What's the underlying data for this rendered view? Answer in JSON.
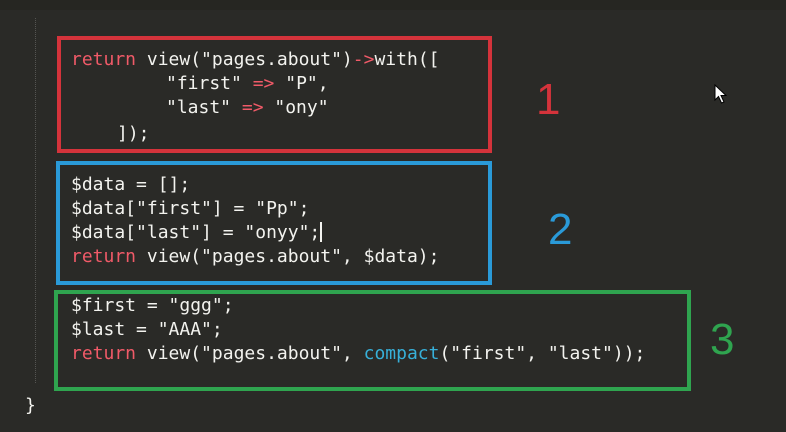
{
  "code": {
    "block1": {
      "l1_kw": "return",
      "l1_a": " view(\"pages.about\")",
      "l1_arrow": "->",
      "l1_b": "with([",
      "l2_a": "\"first\" ",
      "l2_op": "=>",
      "l2_b": " \"P\",",
      "l3_a": "\"last\" ",
      "l3_op": "=>",
      "l3_b": " \"ony\"",
      "l4": "]);"
    },
    "block2": {
      "l1": "$data = [];",
      "l2": "$data[\"first\"] = \"Pp\";",
      "l3": "$data[\"last\"] = \"onyy\";",
      "l4_kw": "return",
      "l4_rest": " view(\"pages.about\", $data);"
    },
    "block3": {
      "l1": "$first = \"ggg\";",
      "l2": "$last = \"AAA\";",
      "l3_kw": "return",
      "l3_a": " view(\"pages.about\", ",
      "l3_fn": "compact",
      "l3_b": "(\"first\", \"last\"));"
    },
    "closing_brace": "}"
  },
  "labels": {
    "one": "1",
    "two": "2",
    "three": "3"
  },
  "colors": {
    "box1": "#d4333b",
    "box2": "#2a9ad8",
    "box3": "#2fa44f",
    "keyword": "#f05a68",
    "function": "#37b0d9",
    "background": "#2a2a27"
  },
  "icons": {
    "cursor": "mouse-pointer-icon"
  }
}
